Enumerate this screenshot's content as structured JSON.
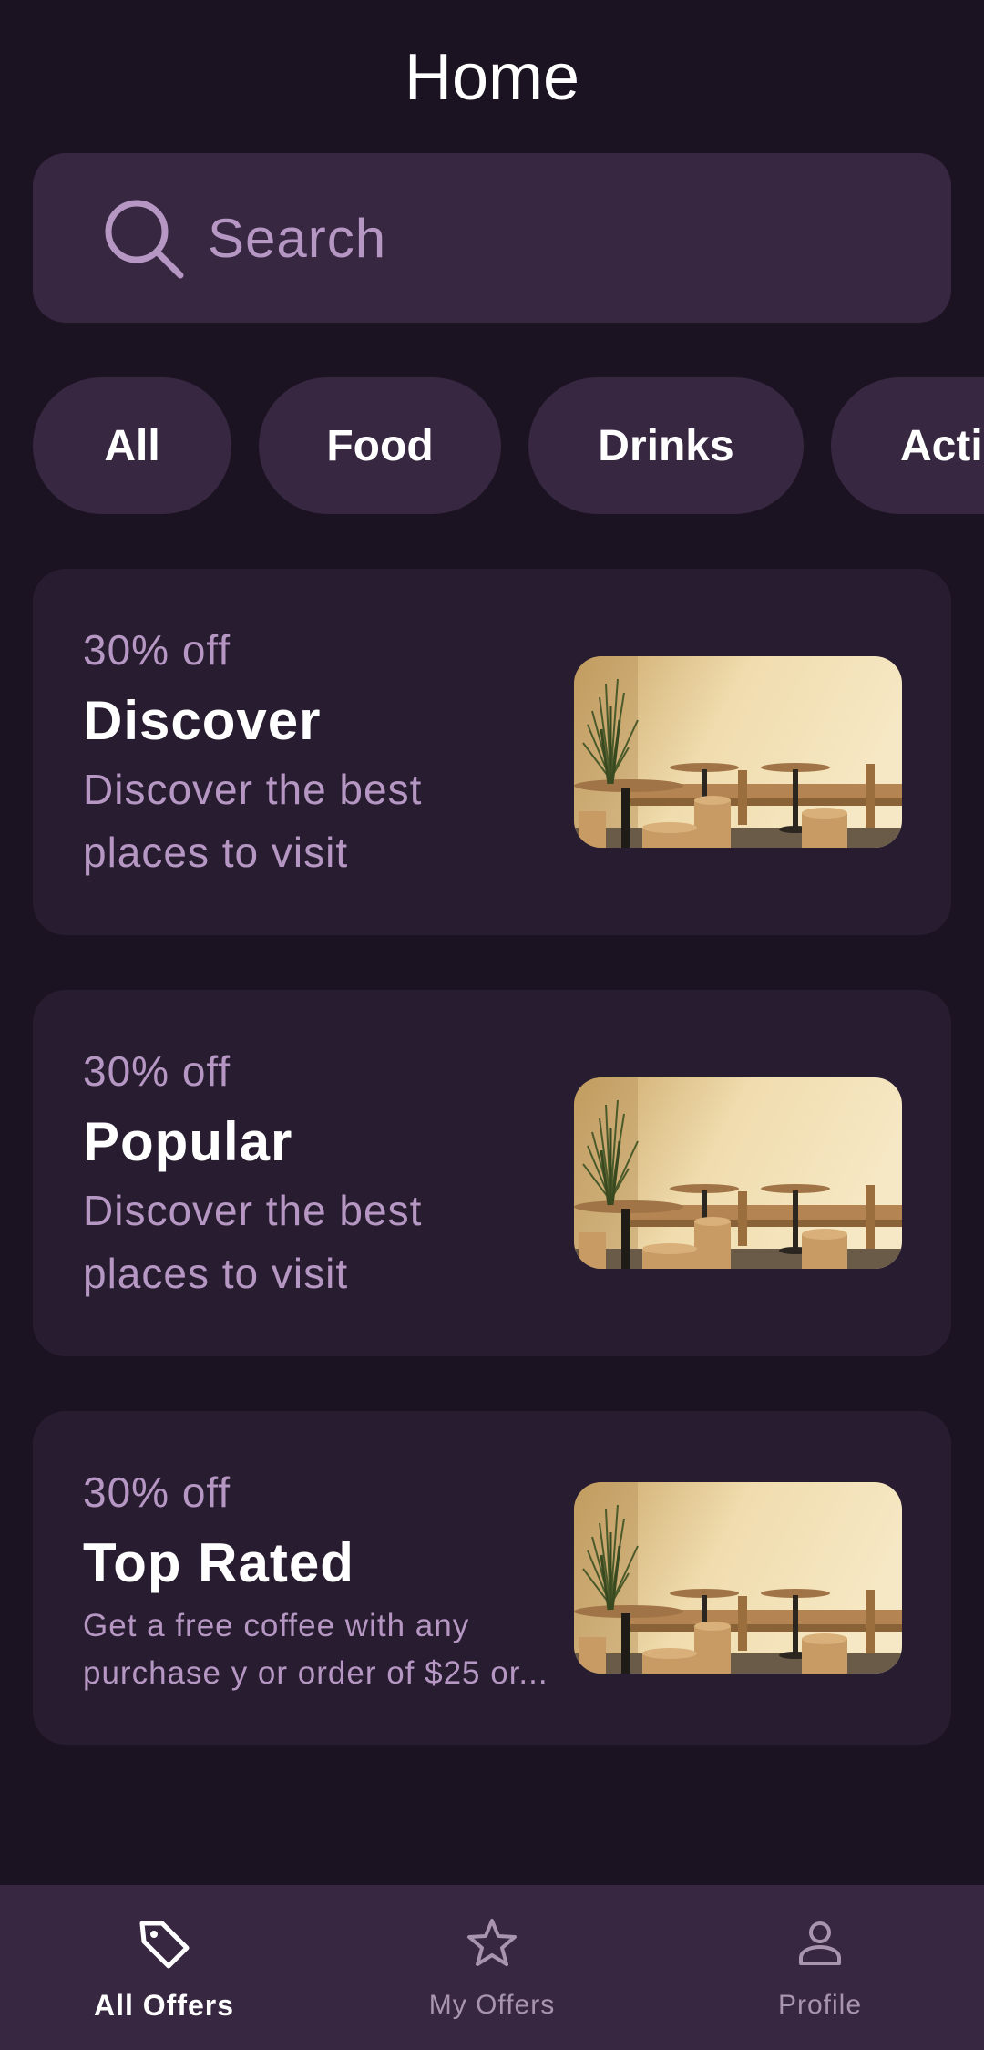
{
  "header": {
    "title": "Home"
  },
  "search": {
    "placeholder": "Search",
    "icon": "search-icon"
  },
  "categories": [
    {
      "label": "All"
    },
    {
      "label": "Food"
    },
    {
      "label": "Drinks"
    },
    {
      "label": "Acti"
    }
  ],
  "offers": [
    {
      "discount": "30% off",
      "title": "Discover",
      "description": "Discover the best places to visit"
    },
    {
      "discount": "30% off",
      "title": "Popular",
      "description": "Discover the best places to visit"
    },
    {
      "discount": "30% off",
      "title": "Top Rated",
      "description": "Get a free coffee with any purchase y or order of $25 or..."
    }
  ],
  "bottom_nav": {
    "items": [
      {
        "label": "All Offers",
        "icon": "tag-icon",
        "active": true
      },
      {
        "label": "My Offers",
        "icon": "star-icon",
        "active": false
      },
      {
        "label": "Profile",
        "icon": "person-icon",
        "active": false
      }
    ]
  },
  "colors": {
    "background": "#1b1222",
    "surface": "#372741",
    "card": "#281d30",
    "accent_text": "#b697c4",
    "nav_inactive": "#a894ad"
  }
}
